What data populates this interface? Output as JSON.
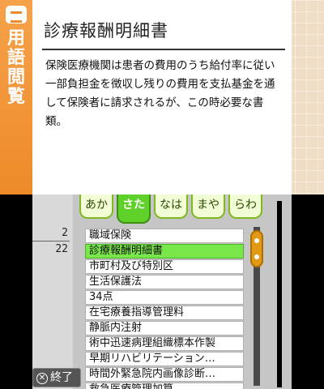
{
  "top_screen": {
    "side_tab": {
      "label": "用語閲覧",
      "icon": "book-icon"
    },
    "term_title": "診療報酬明細書",
    "term_description": "保険医療機関は患者の費用のうち給付率に従い一部負担金を徴収し残りの費用を支払基金を通して保険者に請求されるが、この時必要な書類。"
  },
  "bottom_screen": {
    "pager": {
      "current": "2",
      "total": "22"
    },
    "kana_tabs": [
      {
        "label": "あか",
        "active": false
      },
      {
        "label": "さた",
        "active": true
      },
      {
        "label": "なは",
        "active": false
      },
      {
        "label": "まや",
        "active": false
      },
      {
        "label": "らわ",
        "active": false
      }
    ],
    "list_items": [
      "職域保険",
      "診療報酬明細書",
      "市町村及び特別区",
      "生活保護法",
      "34点",
      "在宅療養指導管理料",
      "静脈内注射",
      "術中迅速病理組織標本作製",
      "早期リハビリテーション…",
      "時間外緊急院内画像診断…",
      "救急医療管理加算"
    ],
    "selected_index": 1,
    "end_button": {
      "label": "終了",
      "icon": "x-circle-icon"
    }
  },
  "colors": {
    "accent_orange": "#ee8a2a",
    "selection_green": "#79e64a",
    "tab_green": "#5fd12a"
  }
}
